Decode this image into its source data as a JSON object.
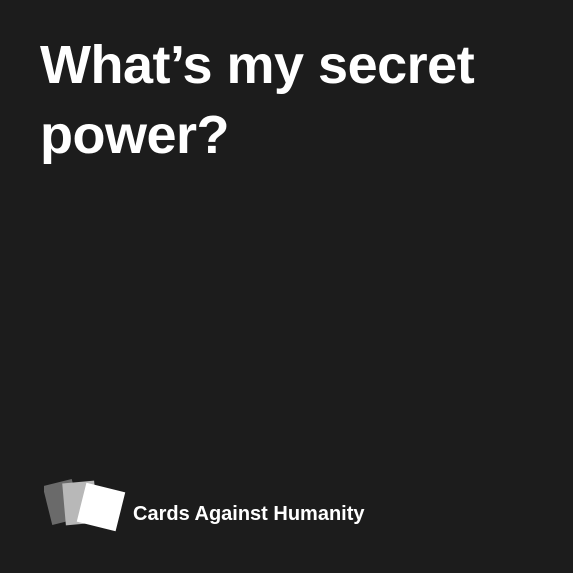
{
  "card": {
    "background": "#1c1c1c",
    "text_color": "#ffffff",
    "prompt": "What’s my secret power?"
  },
  "brand": {
    "logo_icon": "stacked-cards-icon",
    "name": "Cards Against Humanity"
  }
}
